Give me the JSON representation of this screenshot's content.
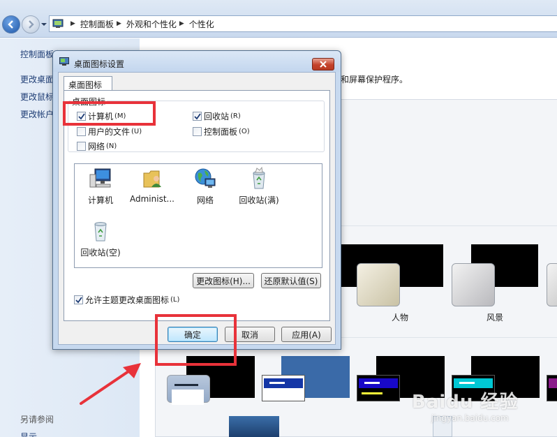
{
  "window": {
    "breadcrumb": [
      "控制面板",
      "外观和个性化",
      "个性化"
    ]
  },
  "left_pane": {
    "links": [
      "控制面板主页",
      "更改桌面图标",
      "更改鼠标指针",
      "更改帐户图片"
    ],
    "see_also": "另请参阅",
    "bottom_link": "显示"
  },
  "main": {
    "description_fragment": "和屏幕保护程序。",
    "themes": [
      {
        "label": "人物"
      },
      {
        "label": "风景"
      }
    ]
  },
  "dialog": {
    "title": "桌面图标设置",
    "tab_label": "桌面图标",
    "group_label": "桌面图标",
    "checkboxes": [
      {
        "label": "计算机",
        "hotkey": "(M)",
        "checked": true
      },
      {
        "label": "回收站",
        "hotkey": "(R)",
        "checked": true
      },
      {
        "label": "用户的文件",
        "hotkey": "(U)",
        "checked": false
      },
      {
        "label": "控制面板",
        "hotkey": "(O)",
        "checked": false
      },
      {
        "label": "网络",
        "hotkey": "(N)",
        "checked": false
      }
    ],
    "icons": [
      {
        "label": "计算机",
        "icon": "computer-icon"
      },
      {
        "label": "Administ...",
        "icon": "user-folder-icon"
      },
      {
        "label": "网络",
        "icon": "network-icon"
      },
      {
        "label": "回收站(满)",
        "icon": "recycle-bin-full-icon"
      },
      {
        "label": "回收站(空)",
        "icon": "recycle-bin-empty-icon"
      }
    ],
    "change_icon_button": "更改图标(H)...",
    "restore_default_button": "还原默认值(S)",
    "allow_themes": {
      "label": "允许主题更改桌面图标",
      "hotkey": "(L)",
      "checked": true
    },
    "ok_button": "确定",
    "cancel_button": "取消",
    "apply_button": "应用(A)"
  },
  "watermark": {
    "main": "Baidu 经验",
    "sub": "jingyan.baidu.com"
  },
  "colors": {
    "annotation_red": "#e8323a",
    "chrome_blue": "#c7d9ef",
    "link_blue": "#1e3d75"
  }
}
